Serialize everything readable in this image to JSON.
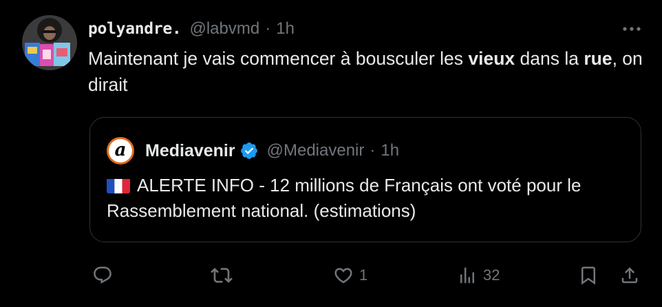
{
  "tweet": {
    "author": {
      "display_name": "polyandre.",
      "handle": "@labvmd",
      "time": "1h"
    },
    "text": {
      "part1": "Maintenant je vais commencer à bousculer les ",
      "bold1": "vieux",
      "part2": " dans la ",
      "bold2": "rue",
      "part3": ", on dirait"
    },
    "more_icon": "more-horizontal-icon"
  },
  "quote": {
    "author": {
      "display_name": "Mediavenir",
      "handle": "@Mediavenir",
      "time": "1h",
      "avatar_glyph": "a",
      "avatar_border_color": "#e06a1b",
      "verified_color": "#1d9bf0"
    },
    "text": "ALERTE INFO - 12 millions de Français ont voté pour le Rassemblement national. (estimations)",
    "flag_icon": "france-flag-icon"
  },
  "actions": {
    "reply": {
      "icon": "reply-icon",
      "count": ""
    },
    "repost": {
      "icon": "repost-icon",
      "count": ""
    },
    "like": {
      "icon": "heart-icon",
      "count": "1"
    },
    "views": {
      "icon": "views-chart-icon",
      "count": "32"
    },
    "bookmark": {
      "icon": "bookmark-icon"
    },
    "share": {
      "icon": "share-icon"
    }
  },
  "colors": {
    "background": "#000000",
    "text_primary": "#e7e9ea",
    "text_secondary": "#71767b",
    "border": "#2f3336",
    "accent": "#1d9bf0"
  }
}
